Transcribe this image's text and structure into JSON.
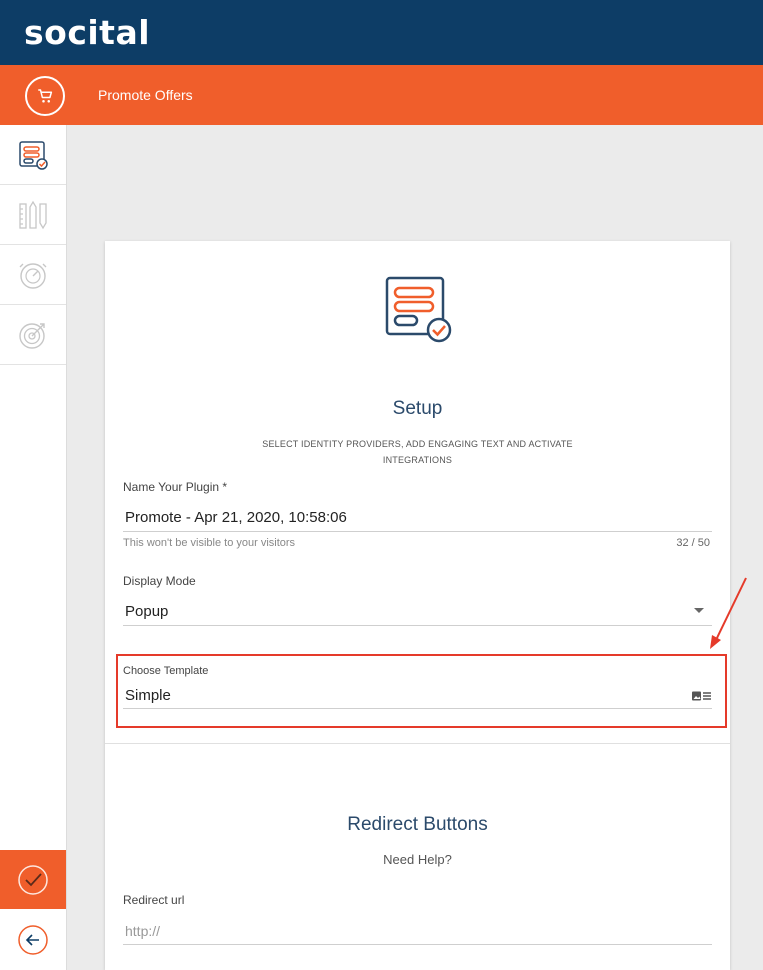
{
  "brand": {
    "logo_text": "socital"
  },
  "header": {
    "title": "Promote Offers",
    "cart_icon": "cart-icon"
  },
  "sidebar": {
    "items": [
      {
        "icon": "setup-list-icon",
        "active": true
      },
      {
        "icon": "design-tools-icon",
        "active": false
      },
      {
        "icon": "timer-icon",
        "active": false
      },
      {
        "icon": "target-icon",
        "active": false
      }
    ],
    "confirm_icon": "checkmark-icon",
    "back_icon": "back-arrow-icon"
  },
  "setup": {
    "title": "Setup",
    "subtitle": "SELECT IDENTITY PROVIDERS, ADD ENGAGING TEXT AND ACTIVATE INTEGRATIONS"
  },
  "form": {
    "name": {
      "label": "Name Your Plugin *",
      "value": "Promote - Apr 21, 2020, 10:58:06",
      "hint": "This won't be visible to your visitors",
      "counter": "32 / 50"
    },
    "display_mode": {
      "label": "Display Mode",
      "value": "Popup"
    },
    "template": {
      "label": "Choose Template",
      "value": "Simple",
      "icon": "template-picker-icon"
    }
  },
  "redirect": {
    "title": "Redirect Buttons",
    "help": "Need Help?",
    "url_label": "Redirect url",
    "url_placeholder": "http://"
  },
  "colors": {
    "navy": "#0d3d66",
    "orange": "#f05e2b",
    "highlight": "#e53a2a"
  }
}
